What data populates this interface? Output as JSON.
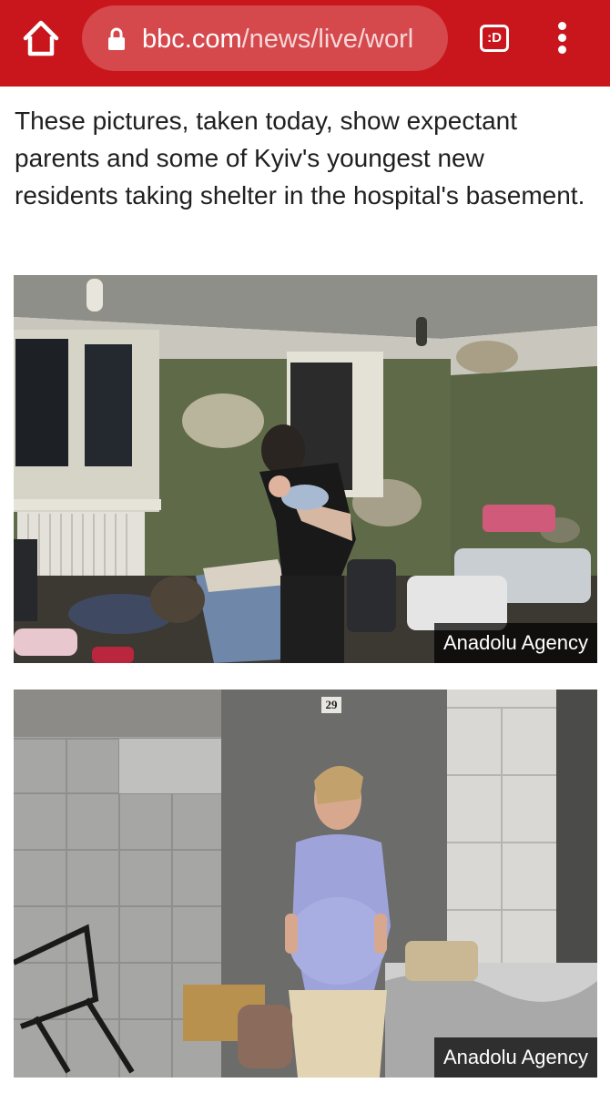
{
  "browser": {
    "url_host": "bbc.com",
    "url_path": "/news/live/worl",
    "tabs_label": ":D"
  },
  "icons": {
    "home": "home-icon",
    "lock": "lock-icon",
    "tabs": "tab-switcher-icon",
    "menu": "more-vertical-icon"
  },
  "colors": {
    "topbar": "#c9161c",
    "text": "#202020"
  },
  "article": {
    "text": "These pictures, taken today, show expectant parents and some of Kyiv's youngest new residents taking shelter in the hospital's basement."
  },
  "photos": [
    {
      "caption": "Anadolu Agency"
    },
    {
      "caption": "Anadolu Agency",
      "door_number": "29"
    }
  ]
}
